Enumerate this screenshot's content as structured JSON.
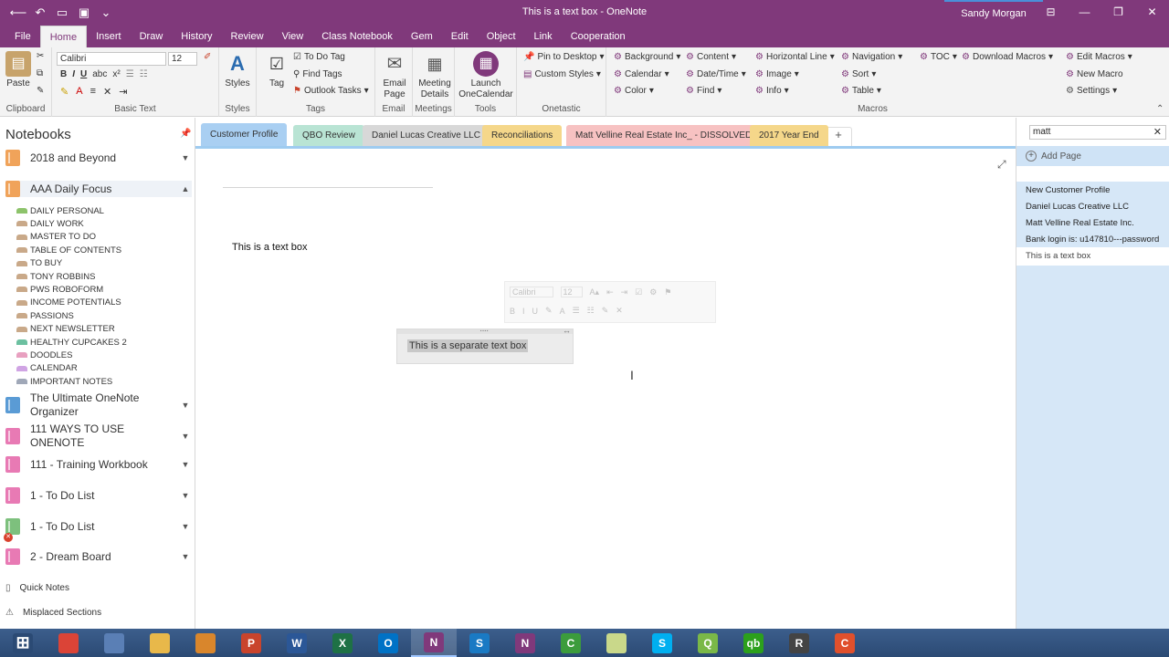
{
  "window": {
    "title": "This is a text box - OneNote",
    "user": "Sandy Morgan"
  },
  "ribbon_tabs": [
    "File",
    "Home",
    "Insert",
    "Draw",
    "History",
    "Review",
    "View",
    "Class Notebook",
    "Gem",
    "Edit",
    "Object",
    "Link",
    "Cooperation"
  ],
  "active_ribbon_tab": "Home",
  "ribbon": {
    "clipboard": {
      "paste": "Paste",
      "label": "Clipboard"
    },
    "basic_text": {
      "font": "Calibri",
      "size": "12",
      "label": "Basic Text"
    },
    "styles": {
      "styles": "Styles",
      "label": "Styles"
    },
    "tags": {
      "tag": "Tag",
      "todo": "To Do Tag",
      "find": "Find Tags",
      "outlook": "Outlook Tasks",
      "label": "Tags"
    },
    "email": {
      "btn": "Email Page",
      "label": "Email"
    },
    "meetings": {
      "btn": "Meeting Details",
      "label": "Meetings"
    },
    "tools": {
      "btn": "Launch OneCalendar",
      "label": "Tools"
    },
    "onetastic": {
      "pin": "Pin to Desktop",
      "custom": "Custom Styles",
      "label": "Onetastic"
    },
    "macros": {
      "background": "Background",
      "content": "Content",
      "hline": "Horizontal Line",
      "navigation": "Navigation",
      "toc": "TOC",
      "calendar": "Calendar",
      "datetime": "Date/Time",
      "image": "Image",
      "sort": "Sort",
      "color": "Color",
      "find": "Find",
      "info": "Info",
      "table": "Table",
      "download": "Download Macros",
      "edit": "Edit Macros",
      "new": "New Macro",
      "settings": "Settings",
      "label": "Macros"
    }
  },
  "sidebar": {
    "heading": "Notebooks",
    "notebooks": [
      {
        "name": "2018 and Beyond",
        "color": "#f0a35a",
        "expanded": false
      },
      {
        "name": "AAA Daily Focus",
        "color": "#f0a35a",
        "expanded": true
      },
      {
        "name": "The Ultimate OneNote Organizer",
        "color": "#5a9bd5",
        "expanded": false
      },
      {
        "name": "111 WAYS TO USE ONENOTE",
        "color": "#e87ab4",
        "expanded": false
      },
      {
        "name": "111 - Training Workbook",
        "color": "#e87ab4",
        "expanded": false
      },
      {
        "name": "1 - To Do List",
        "color": "#e87ab4",
        "expanded": false
      },
      {
        "name": "1 - To Do List",
        "color": "#7dc07d",
        "expanded": false
      },
      {
        "name": "2 - Dream Board",
        "color": "#e87ab4",
        "expanded": false
      }
    ],
    "sections": [
      {
        "name": "DAILY PERSONAL",
        "color": "#8dc36b"
      },
      {
        "name": "DAILY WORK",
        "color": "#c9a989"
      },
      {
        "name": "MASTER TO DO",
        "color": "#c9a989"
      },
      {
        "name": "TABLE OF CONTENTS",
        "color": "#c9a989"
      },
      {
        "name": "TO BUY",
        "color": "#c9a989"
      },
      {
        "name": "TONY ROBBINS",
        "color": "#c9a989"
      },
      {
        "name": "PWS ROBOFORM",
        "color": "#c9a989"
      },
      {
        "name": "INCOME POTENTIALS",
        "color": "#c9a989"
      },
      {
        "name": "PASSIONS",
        "color": "#c9a989"
      },
      {
        "name": "NEXT NEWSLETTER",
        "color": "#c9a989"
      },
      {
        "name": "HEALTHY CUPCAKES 2",
        "color": "#6cc0a0"
      },
      {
        "name": "DOODLES",
        "color": "#e8a0c0"
      },
      {
        "name": "CALENDAR",
        "color": "#d0a4e4"
      },
      {
        "name": "IMPORTANT NOTES",
        "color": "#a0a8b8"
      }
    ],
    "quick_notes": "Quick Notes",
    "misplaced": "Misplaced Sections"
  },
  "section_tabs": [
    {
      "name": "Customer Profile",
      "color": "#a9cff2",
      "active": true
    },
    {
      "name": "QBO Review",
      "color": "#b9e4d4",
      "active": false
    },
    {
      "name": "Daniel Lucas Creative LLC",
      "color": "#d8d8d8",
      "active": false
    },
    {
      "name": "Reconciliations",
      "color": "#f5d78a",
      "active": false
    },
    {
      "name": "Matt Velline Real Estate Inc_ - DISSOLVED",
      "color": "#f7c2c2",
      "active": false
    },
    {
      "name": "2017 Year End",
      "color": "#f5d78a",
      "active": false
    }
  ],
  "add_tab": "+",
  "page": {
    "text_box_1": "This is a text box",
    "text_box_2": "This is a separate text box",
    "mini_toolbar": {
      "font": "Calibri",
      "size": "12"
    }
  },
  "right_pane": {
    "search": "matt",
    "add_page": "Add Page",
    "pages": [
      {
        "name": "New Customer Profile",
        "selected": false
      },
      {
        "name": "Daniel Lucas Creative LLC",
        "selected": false
      },
      {
        "name": "Matt Velline Real Estate Inc.",
        "selected": false
      },
      {
        "name": "Bank login is: u147810---password",
        "selected": false
      },
      {
        "name": "This is a text box",
        "selected": true
      }
    ]
  },
  "taskbar": [
    {
      "app": "Start",
      "color": "#2b4a74",
      "glyph": ""
    },
    {
      "app": "Chrome",
      "color": "#db4437",
      "glyph": ""
    },
    {
      "app": "Calculator",
      "color": "#5a7fb5",
      "glyph": ""
    },
    {
      "app": "File Explorer",
      "color": "#e8b84a",
      "glyph": ""
    },
    {
      "app": "Paint",
      "color": "#d9862c",
      "glyph": ""
    },
    {
      "app": "PowerPoint",
      "color": "#c9442c",
      "glyph": "P"
    },
    {
      "app": "Word",
      "color": "#2b5797",
      "glyph": "W"
    },
    {
      "app": "Excel",
      "color": "#1e7145",
      "glyph": "X"
    },
    {
      "app": "Outlook",
      "color": "#0072c6",
      "glyph": "O"
    },
    {
      "app": "OneNote",
      "color": "#80397b",
      "glyph": "N"
    },
    {
      "app": "Snagit",
      "color": "#1a7ac4",
      "glyph": "S"
    },
    {
      "app": "OneNote 2016",
      "color": "#80397b",
      "glyph": "N"
    },
    {
      "app": "Camtasia",
      "color": "#3c9c3c",
      "glyph": "C"
    },
    {
      "app": "Folder",
      "color": "#c9d88a",
      "glyph": ""
    },
    {
      "app": "Skype",
      "color": "#00aff0",
      "glyph": "S"
    },
    {
      "app": "QuickBooks",
      "color": "#7ab848",
      "glyph": "Q"
    },
    {
      "app": "QuickBooks Online",
      "color": "#2ca01c",
      "glyph": "qb"
    },
    {
      "app": "Recorder",
      "color": "#444444",
      "glyph": "R"
    },
    {
      "app": "Camtasia Recorder",
      "color": "#e0502c",
      "glyph": "C"
    }
  ]
}
